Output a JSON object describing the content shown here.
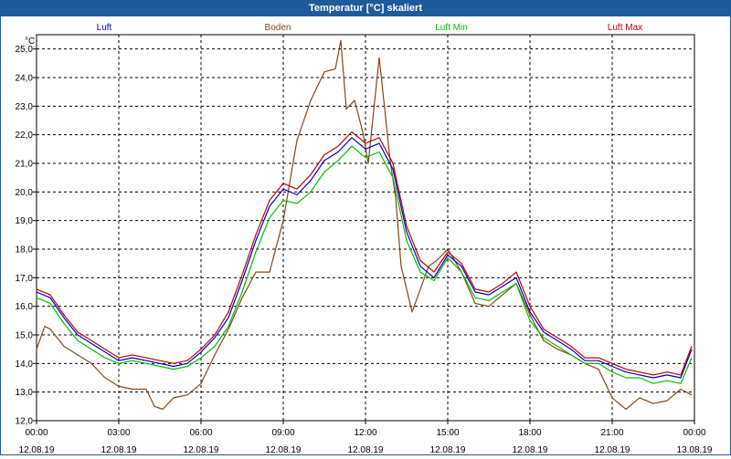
{
  "window": {
    "title": "Temperatur [°C] skaliert"
  },
  "chart_data": {
    "type": "line",
    "ylabel": "°C",
    "ylim": [
      12.0,
      25.5
    ],
    "y_ticks": [
      "12,0",
      "13,0",
      "14,0",
      "15,0",
      "16,0",
      "17,0",
      "18,0",
      "19,0",
      "20,0",
      "21,0",
      "22,0",
      "23,0",
      "24,0",
      "25,0"
    ],
    "x_ticks": [
      {
        "time": "00:00",
        "date": "12.08.19"
      },
      {
        "time": "03:00",
        "date": "12.08.19"
      },
      {
        "time": "06:00",
        "date": "12.08.19"
      },
      {
        "time": "09:00",
        "date": "12.08.19"
      },
      {
        "time": "12:00",
        "date": "12.08.19"
      },
      {
        "time": "15:00",
        "date": "12.08.19"
      },
      {
        "time": "18:00",
        "date": "12.08.19"
      },
      {
        "time": "21:00",
        "date": "12.08.19"
      },
      {
        "time": "00:00",
        "date": "13.08.19"
      }
    ],
    "grid": true,
    "legend_position": "top",
    "x_unit": "hours since 12.08.19 00:00",
    "series": [
      {
        "name": "Luft",
        "color": "#0000c8",
        "x": [
          0,
          0.5,
          1,
          1.5,
          2,
          2.5,
          3,
          3.5,
          4,
          4.5,
          5,
          5.5,
          6,
          6.5,
          7,
          7.5,
          8,
          8.5,
          9,
          9.5,
          10,
          10.5,
          11,
          11.5,
          12,
          12.5,
          13,
          13.5,
          14,
          14.5,
          15,
          15.5,
          16,
          16.5,
          17,
          17.5,
          18,
          18.5,
          19,
          19.5,
          20,
          20.5,
          21,
          21.5,
          22,
          22.5,
          23,
          23.5,
          23.9
        ],
        "y": [
          16.5,
          16.3,
          15.6,
          15.0,
          14.7,
          14.4,
          14.1,
          14.2,
          14.1,
          14.0,
          13.9,
          14.0,
          14.4,
          14.9,
          15.6,
          16.9,
          18.3,
          19.5,
          20.1,
          19.9,
          20.4,
          21.1,
          21.4,
          21.9,
          21.5,
          21.7,
          20.8,
          18.6,
          17.4,
          17.0,
          17.8,
          17.4,
          16.5,
          16.4,
          16.7,
          17.0,
          15.8,
          15.1,
          14.8,
          14.5,
          14.1,
          14.1,
          13.9,
          13.7,
          13.6,
          13.5,
          13.6,
          13.5,
          14.5
        ]
      },
      {
        "name": "Boden",
        "color": "#8b4513",
        "x": [
          0,
          0.3,
          0.5,
          1,
          1.5,
          2,
          2.5,
          3,
          3.5,
          4,
          4.3,
          4.6,
          5,
          5.5,
          6,
          6.5,
          7,
          7.5,
          8,
          8.5,
          9,
          9.5,
          10,
          10.5,
          10.9,
          11.1,
          11.3,
          11.6,
          11.9,
          12.1,
          12.5,
          12.9,
          13.1,
          13.3,
          13.7,
          14.0,
          14.3,
          14.6,
          15.0,
          15.5,
          16.0,
          16.5,
          17.0,
          17.5,
          18.0,
          18.5,
          19.0,
          19.5,
          20.0,
          20.5,
          21.0,
          21.5,
          22.0,
          22.5,
          23.0,
          23.5,
          23.9
        ],
        "y": [
          14.5,
          15.3,
          15.2,
          14.6,
          14.3,
          14.0,
          13.5,
          13.2,
          13.1,
          13.1,
          12.5,
          12.4,
          12.8,
          12.9,
          13.3,
          14.3,
          15.2,
          16.3,
          17.2,
          17.2,
          19.0,
          21.8,
          23.2,
          24.2,
          24.3,
          25.3,
          22.9,
          23.2,
          22.1,
          21.0,
          24.7,
          21.1,
          19.8,
          17.4,
          15.8,
          16.6,
          17.4,
          17.6,
          18.0,
          17.2,
          16.1,
          16.0,
          16.4,
          16.8,
          15.7,
          14.8,
          14.5,
          14.3,
          14.0,
          13.8,
          12.8,
          12.4,
          12.8,
          12.6,
          12.7,
          13.1,
          12.9
        ]
      },
      {
        "name": "Luft Min",
        "color": "#00c000",
        "x": [
          0,
          0.5,
          1,
          1.5,
          2,
          2.5,
          3,
          3.5,
          4,
          4.5,
          5,
          5.5,
          6,
          6.5,
          7,
          7.5,
          8,
          8.5,
          9,
          9.5,
          10,
          10.5,
          11,
          11.5,
          12,
          12.5,
          13,
          13.5,
          14,
          14.5,
          15,
          15.5,
          16,
          16.5,
          17,
          17.5,
          18,
          18.5,
          19,
          19.5,
          20,
          20.5,
          21,
          21.5,
          22,
          22.5,
          23,
          23.5,
          23.9
        ],
        "y": [
          16.3,
          16.1,
          15.4,
          14.8,
          14.5,
          14.2,
          14.0,
          14.1,
          14.0,
          13.9,
          13.8,
          13.9,
          14.2,
          14.6,
          15.3,
          16.5,
          17.9,
          19.1,
          19.7,
          19.6,
          20.0,
          20.7,
          21.1,
          21.6,
          21.2,
          21.4,
          20.5,
          18.3,
          17.2,
          16.9,
          17.7,
          17.2,
          16.3,
          16.2,
          16.5,
          16.8,
          15.5,
          14.9,
          14.6,
          14.3,
          14.0,
          14.0,
          13.7,
          13.5,
          13.5,
          13.3,
          13.4,
          13.3,
          14.2
        ]
      },
      {
        "name": "Luft Max",
        "color": "#c00000",
        "x": [
          0,
          0.5,
          1,
          1.5,
          2,
          2.5,
          3,
          3.5,
          4,
          4.5,
          5,
          5.5,
          6,
          6.5,
          7,
          7.5,
          8,
          8.5,
          9,
          9.5,
          10,
          10.5,
          11,
          11.5,
          12,
          12.5,
          13,
          13.5,
          14,
          14.5,
          15,
          15.5,
          16,
          16.5,
          17,
          17.5,
          18,
          18.5,
          19,
          19.5,
          20,
          20.5,
          21,
          21.5,
          22,
          22.5,
          23,
          23.5,
          23.9
        ],
        "y": [
          16.6,
          16.4,
          15.7,
          15.1,
          14.8,
          14.5,
          14.2,
          14.3,
          14.2,
          14.1,
          14.0,
          14.1,
          14.5,
          15.0,
          15.8,
          17.1,
          18.5,
          19.7,
          20.3,
          20.1,
          20.6,
          21.3,
          21.6,
          22.1,
          21.7,
          21.9,
          21.0,
          18.8,
          17.6,
          17.2,
          17.9,
          17.5,
          16.6,
          16.5,
          16.8,
          17.2,
          16.0,
          15.2,
          14.9,
          14.6,
          14.2,
          14.2,
          14.0,
          13.8,
          13.7,
          13.6,
          13.7,
          13.6,
          14.6
        ]
      }
    ]
  }
}
